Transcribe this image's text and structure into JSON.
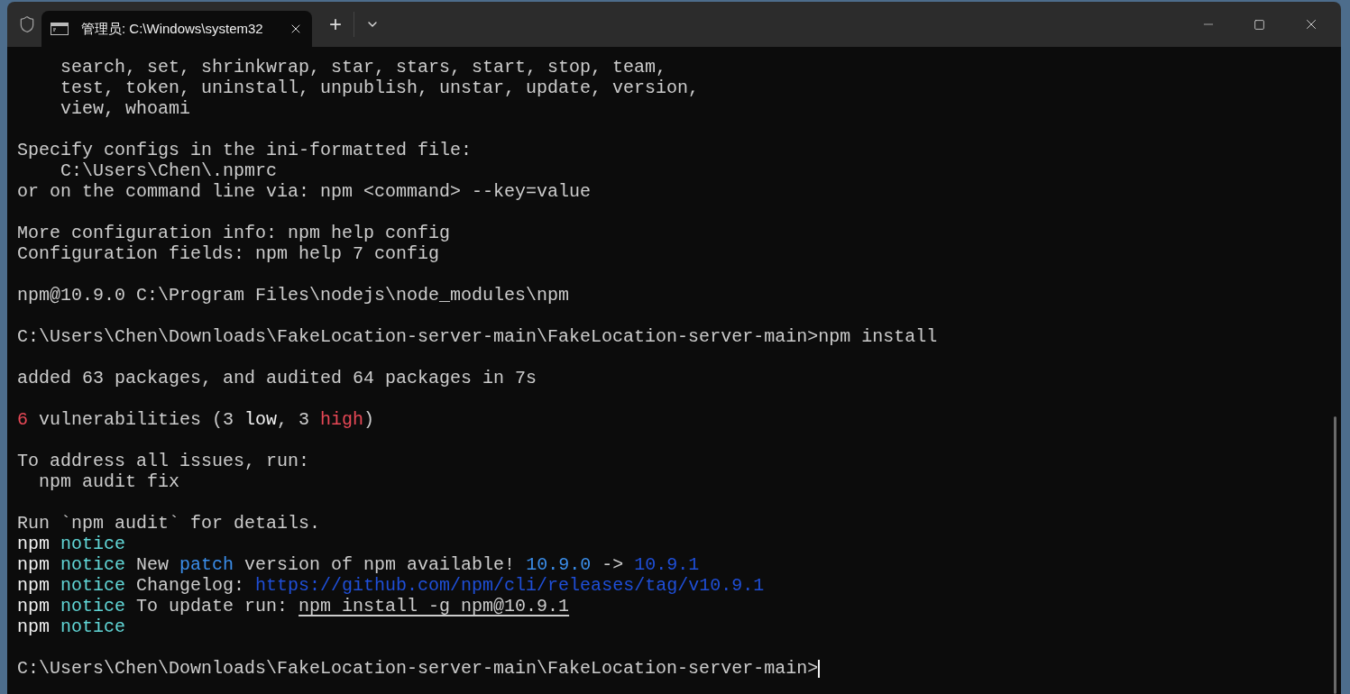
{
  "tab": {
    "title": "管理员: C:\\Windows\\system32",
    "selected": true
  },
  "new_tab_button": "+",
  "lines": [
    {
      "segments": [
        {
          "text": "    search, set, shrinkwrap, star, stars, start, stop, team,",
          "kind": "normal"
        }
      ]
    },
    {
      "segments": [
        {
          "text": "    test, token, uninstall, unpublish, unstar, update, version,",
          "kind": "normal"
        }
      ]
    },
    {
      "segments": [
        {
          "text": "    view, whoami",
          "kind": "normal"
        }
      ]
    },
    {
      "kind": "blank"
    },
    {
      "segments": [
        {
          "text": "Specify configs in the ini-formatted file:",
          "kind": "normal"
        }
      ]
    },
    {
      "segments": [
        {
          "text": "    C:\\Users\\Chen\\.npmrc",
          "kind": "normal"
        }
      ]
    },
    {
      "segments": [
        {
          "text": "or on the command line via: npm <command> --key=value",
          "kind": "normal"
        }
      ]
    },
    {
      "kind": "blank"
    },
    {
      "segments": [
        {
          "text": "More configuration info: npm help config",
          "kind": "normal"
        }
      ]
    },
    {
      "segments": [
        {
          "text": "Configuration fields: npm help 7 config",
          "kind": "normal"
        }
      ]
    },
    {
      "kind": "blank"
    },
    {
      "segments": [
        {
          "text": "npm@10.9.0 C:\\Program Files\\nodejs\\node_modules\\npm",
          "kind": "normal"
        }
      ]
    },
    {
      "kind": "blank"
    },
    {
      "segments": [
        {
          "text": "C:\\Users\\Chen\\Downloads\\FakeLocation-server-main\\FakeLocation-server-main>npm install",
          "kind": "normal"
        }
      ]
    },
    {
      "kind": "blank"
    },
    {
      "segments": [
        {
          "text": "added 63 packages, and audited 64 packages in 7s",
          "kind": "normal"
        }
      ]
    },
    {
      "kind": "blank"
    },
    {
      "segments": [
        {
          "text": "6",
          "kind": "red"
        },
        {
          "text": " vulnerabilities (3 ",
          "kind": "normal"
        },
        {
          "text": "low",
          "kind": "bright"
        },
        {
          "text": ", 3 ",
          "kind": "normal"
        },
        {
          "text": "high",
          "kind": "red"
        },
        {
          "text": ")",
          "kind": "normal"
        }
      ]
    },
    {
      "kind": "blank"
    },
    {
      "segments": [
        {
          "text": "To address all issues, run:",
          "kind": "normal"
        }
      ]
    },
    {
      "segments": [
        {
          "text": "  npm audit fix",
          "kind": "normal"
        }
      ]
    },
    {
      "kind": "blank"
    },
    {
      "segments": [
        {
          "text": "Run `npm audit` for details.",
          "kind": "normal"
        }
      ]
    },
    {
      "segments": [
        {
          "text": "npm ",
          "kind": "bright"
        },
        {
          "text": "notice",
          "kind": "cyan"
        }
      ]
    },
    {
      "segments": [
        {
          "text": "npm ",
          "kind": "bright"
        },
        {
          "text": "notice",
          "kind": "cyan"
        },
        {
          "text": " New ",
          "kind": "normal"
        },
        {
          "text": "patch",
          "kind": "blue"
        },
        {
          "text": " version of npm available! ",
          "kind": "normal"
        },
        {
          "text": "10.9.0",
          "kind": "blue"
        },
        {
          "text": " -> ",
          "kind": "normal"
        },
        {
          "text": "10.9.1",
          "kind": "darkblue"
        }
      ]
    },
    {
      "segments": [
        {
          "text": "npm ",
          "kind": "bright"
        },
        {
          "text": "notice",
          "kind": "cyan"
        },
        {
          "text": " Changelog: ",
          "kind": "normal"
        },
        {
          "text": "https://github.com/npm/cli/releases/tag/v10.9.1",
          "kind": "darkblue"
        }
      ]
    },
    {
      "segments": [
        {
          "text": "npm ",
          "kind": "bright"
        },
        {
          "text": "notice",
          "kind": "cyan"
        },
        {
          "text": " To update run: ",
          "kind": "normal"
        },
        {
          "text": "npm install -g npm@10.9.1",
          "kind": "underline"
        }
      ]
    },
    {
      "segments": [
        {
          "text": "npm ",
          "kind": "bright"
        },
        {
          "text": "notice",
          "kind": "cyan"
        }
      ]
    },
    {
      "kind": "blank"
    },
    {
      "segments": [
        {
          "text": "C:\\Users\\Chen\\Downloads\\FakeLocation-server-main\\FakeLocation-server-main>",
          "kind": "normal"
        }
      ],
      "cursor": true
    }
  ]
}
